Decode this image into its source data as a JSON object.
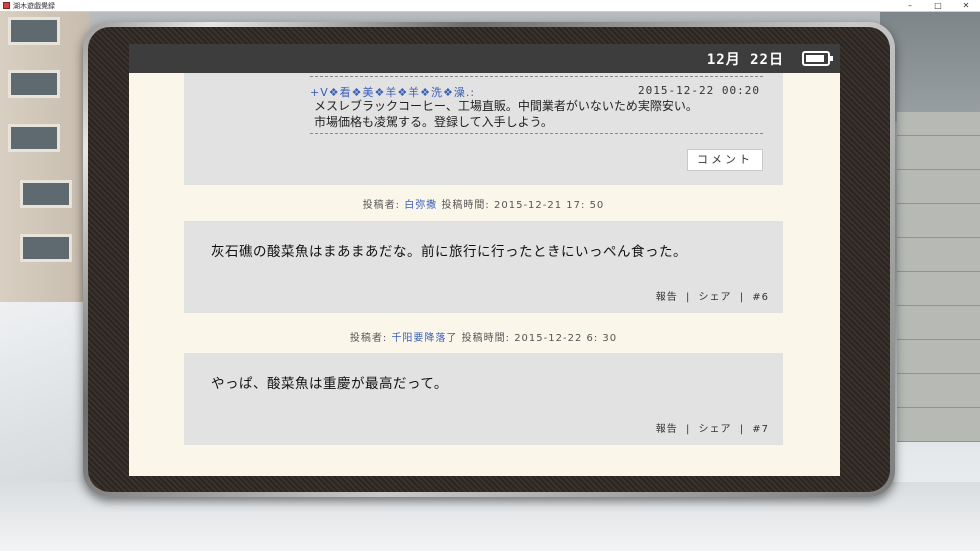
{
  "window": {
    "title": "湖木遊戯覺録"
  },
  "status": {
    "date": "12月 22日",
    "battery_level": 0.9
  },
  "reply": {
    "author": "+V❖看❖美❖羊❖羊❖洗❖澡.:",
    "time": "2015-12-22 00:20",
    "lines": [
      "メスレブラックコーヒー、工場直販。中間業者がいないため実際安い。",
      "市場価格も凌駕する。登録して入手しよう。"
    ],
    "comment_button": "コメント"
  },
  "posts": [
    {
      "author_label": "投稿者:",
      "author": "白弥撒",
      "time_label": "投稿時間:",
      "time": "2015-12-21 17: 50",
      "text": "灰石礁の酸菜魚はまあまあだな。前に旅行に行ったときにいっぺん食った。",
      "report": "報告",
      "share": "シェア",
      "number": "#6"
    },
    {
      "author_label": "投稿者:",
      "author": "千阳要降落了",
      "time_label": "投稿時間:",
      "time": "2015-12-22 6: 30",
      "text": "やっぱ、酸菜魚は重慶が最高だって。",
      "report": "報告",
      "share": "シェア",
      "number": "#7"
    }
  ],
  "separator": "|",
  "colors": {
    "link": "#3a5fb8",
    "screen_bg": "#fbf6ea",
    "panel_bg": "#e2e2e2",
    "statusbar": "#3d3d3d"
  }
}
